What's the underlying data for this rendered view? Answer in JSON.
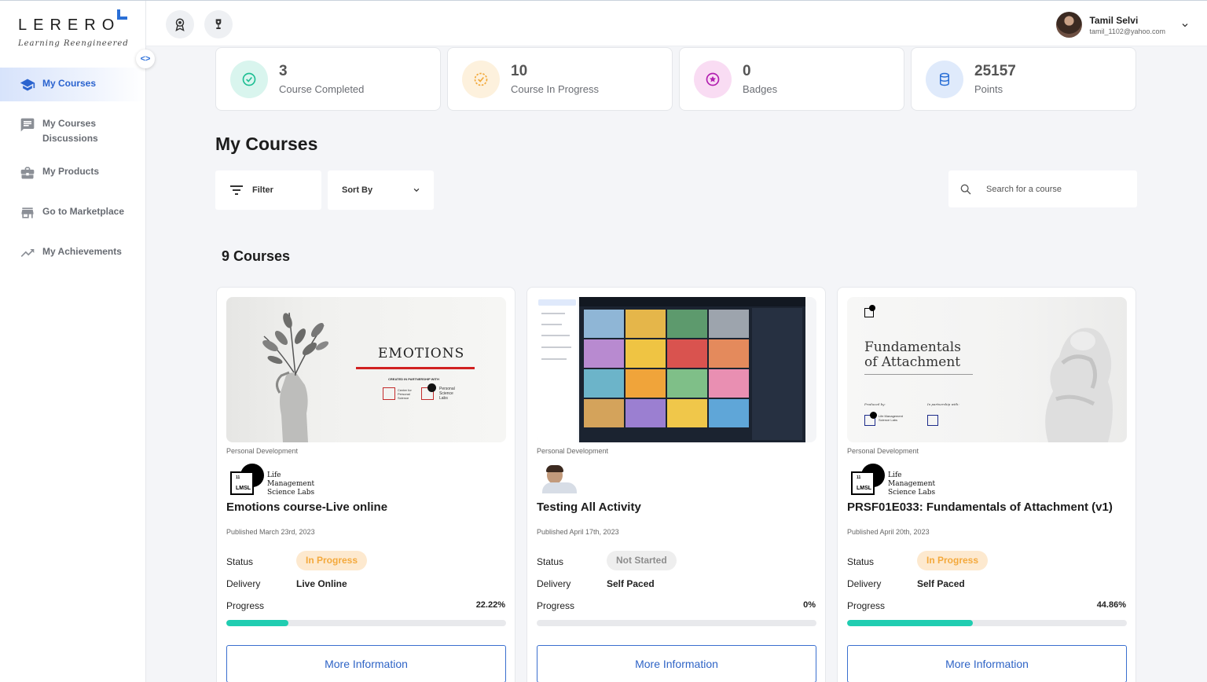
{
  "brand": {
    "name": "LERERO",
    "tagline": "Learning Reengineered"
  },
  "sidebar": {
    "toggle_glyph": "<>",
    "items": [
      {
        "label": "My Courses",
        "icon": "graduation-cap-icon",
        "active": true
      },
      {
        "label": "My Courses Discussions",
        "icon": "chat-icon",
        "active": false
      },
      {
        "label": "My Products",
        "icon": "briefcase-icon",
        "active": false
      },
      {
        "label": "Go to Marketplace",
        "icon": "store-icon",
        "active": false
      },
      {
        "label": "My Achievements",
        "icon": "trending-up-icon",
        "active": false
      }
    ]
  },
  "topbar": {
    "icons": [
      "badge-ribbon-icon",
      "trophy-icon"
    ],
    "user": {
      "name": "Tamil Selvi",
      "email": "tamil_1102@yahoo.com"
    }
  },
  "stats": [
    {
      "value": "3",
      "label": "Course Completed",
      "icon": "check-circle-icon",
      "bg": "#d9f5ee",
      "color": "#1fbf94"
    },
    {
      "value": "10",
      "label": "Course In Progress",
      "icon": "progress-check-icon",
      "bg": "#fdf1dd",
      "color": "#f2a93b"
    },
    {
      "value": "0",
      "label": "Badges",
      "icon": "star-circle-icon",
      "bg": "#f9dcf3",
      "color": "#b21fb0"
    },
    {
      "value": "25157",
      "label": "Points",
      "icon": "database-icon",
      "bg": "#dfeafb",
      "color": "#2a6fd6"
    }
  ],
  "main": {
    "title": "My Courses",
    "filter_label": "Filter",
    "sort_label": "Sort By",
    "search_placeholder": "Search for a course",
    "count_label": "9 Courses"
  },
  "courses": [
    {
      "category": "Personal Development",
      "title": "Emotions course-Live online",
      "published": "Published March 23rd, 2023",
      "status_label": "Status",
      "status": "In Progress",
      "delivery_label": "Delivery",
      "delivery": "Live Online",
      "progress_label": "Progress",
      "progress": "22.22%",
      "progress_value": 22.22,
      "button": "More Information",
      "thumb": {
        "title": "EMOTIONS",
        "partner_line": "CREATED IN PARTNERSHIP WITH",
        "partner_a": "Center for Personal Science",
        "partner_b": "Personal Science Labs"
      },
      "brand": {
        "code": "LMSL",
        "num": "11",
        "name": "Life Management Science Labs"
      }
    },
    {
      "category": "Personal Development",
      "title": "Testing All Activity",
      "published": "Published April 17th, 2023",
      "status_label": "Status",
      "status": "Not Started",
      "delivery_label": "Delivery",
      "delivery": "Self Paced",
      "progress_label": "Progress",
      "progress": "0%",
      "progress_value": 0,
      "button": "More Information"
    },
    {
      "category": "Personal Development",
      "title": "PRSF01E033: Fundamentals of Attachment (v1)",
      "published": "Published April 20th, 2023",
      "status_label": "Status",
      "status": "In Progress",
      "delivery_label": "Delivery",
      "delivery": "Self Paced",
      "progress_label": "Progress",
      "progress": "44.86%",
      "progress_value": 44.86,
      "button": "More Information",
      "thumb": {
        "title": "Fundamentals of Attachment",
        "produced": "Produced by:",
        "partnership": "In partnership with:",
        "org": "Life Management Science Labs"
      },
      "brand": {
        "code": "LMSL",
        "num": "11",
        "name": "Life Management Science Labs"
      }
    }
  ]
}
